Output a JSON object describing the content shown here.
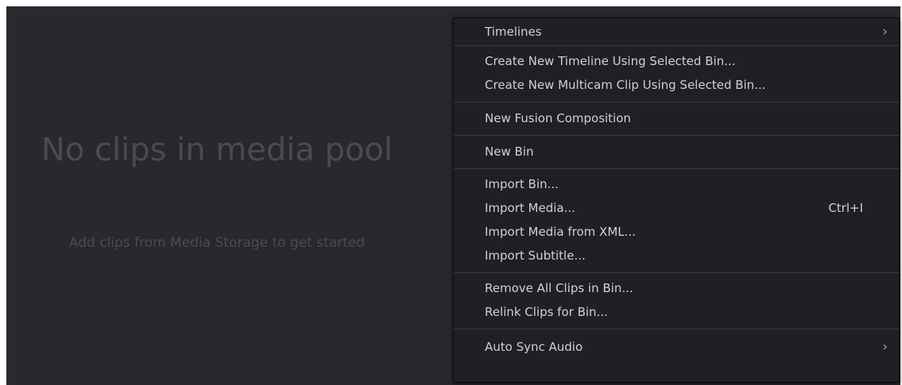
{
  "empty_state": {
    "title": "No clips in media pool",
    "subtitle": "Add clips from Media Storage to get started"
  },
  "context_menu": {
    "timelines": {
      "label": "Timelines",
      "chevron": "›"
    },
    "create_timeline": "Create New Timeline Using Selected Bin...",
    "create_multicam": "Create New Multicam Clip Using Selected Bin...",
    "new_fusion": "New Fusion Composition",
    "new_bin": "New Bin",
    "import_bin": "Import Bin...",
    "import_media": {
      "label": "Import Media...",
      "shortcut": "Ctrl+I"
    },
    "import_xml": "Import Media from XML...",
    "import_subtitle": "Import Subtitle...",
    "remove_all": "Remove All Clips in Bin...",
    "relink": "Relink Clips for Bin...",
    "auto_sync": {
      "label": "Auto Sync Audio",
      "chevron": "›"
    }
  },
  "colors": {
    "panel_bg": "#28282e",
    "menu_bg": "#1f1f24",
    "menu_text": "#d0d0d4",
    "separator": "#3a3a40",
    "placeholder_text": "#4a4a50"
  },
  "icons": [
    "chevron-right-icon"
  ]
}
